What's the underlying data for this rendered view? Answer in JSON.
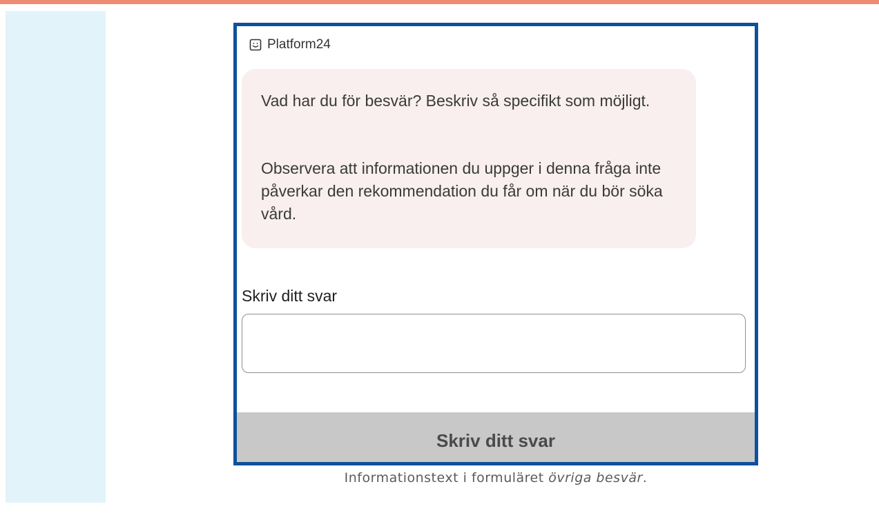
{
  "colors": {
    "top_bar": "#ee8c73",
    "side_strip": "#e2f4f9",
    "frame_border": "#0d519c",
    "bubble_bg": "#f8efee",
    "button_bg": "#c8c8c8"
  },
  "header": {
    "brand_icon": "chat-smile-icon",
    "brand_name": "Platform24"
  },
  "message": {
    "paragraph1": "Vad har du för besvär? Beskriv så specifikt som möjligt.",
    "paragraph2": "Observera att informationen du uppger i denna fråga inte påverkar den rekommendation du får om när du bör söka vård."
  },
  "form": {
    "answer_label": "Skriv ditt svar",
    "answer_value": "",
    "submit_label": "Skriv ditt svar"
  },
  "caption": {
    "text": "Informationstext i formuläret ",
    "emphasis": "övriga besvär",
    "suffix": "."
  }
}
